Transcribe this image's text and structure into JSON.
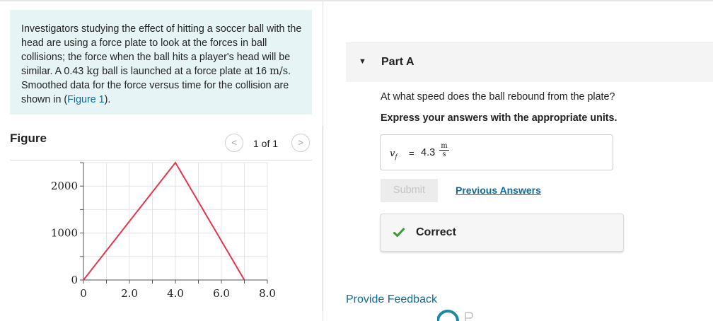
{
  "problem": {
    "text_1": "Investigators studying the effect of hitting a soccer ball with the head are using a force plate to look at the forces in ball collisions; the force when the ball hits a player's head will be similar. A 0.43 ",
    "mass_unit": "kg",
    "text_2": " ball is launched at a force plate at 16 ",
    "speed_unit": "m/s",
    "text_3": ". Smoothed data for the force versus time for the collision are shown in (",
    "figure_link": "Figure 1",
    "text_4": ")."
  },
  "figure": {
    "label": "Figure",
    "pager_text": "1 of 1",
    "prev_glyph": "<",
    "next_glyph": ">"
  },
  "chart_data": {
    "type": "line",
    "x": [
      0,
      4.0,
      7.0
    ],
    "series": [
      {
        "values": [
          0,
          2500,
          0
        ],
        "color": "#e8344a"
      }
    ],
    "x_ticks": [
      "0",
      "2.0",
      "4.0",
      "6.0",
      "8.0"
    ],
    "y_ticks": [
      "0",
      "1000",
      "2000"
    ],
    "xlim": [
      0,
      8.0
    ],
    "ylim": [
      0,
      2500
    ],
    "grid": true,
    "title": "",
    "xlabel": "",
    "ylabel": ""
  },
  "part": {
    "title": "Part A",
    "caret": "▼",
    "question": "At what speed does the ball rebound from the plate?",
    "instruction": "Express your answers with the appropriate units."
  },
  "answer": {
    "variable": "v",
    "subscript": "f",
    "equals": "=",
    "value": "4.3",
    "unit_numerator": "m",
    "unit_denominator": "s"
  },
  "buttons": {
    "submit": "Submit",
    "previous_answers": "Previous Answers"
  },
  "status": {
    "text": "Correct",
    "color": "#3a9a3a"
  },
  "footer": {
    "feedback": "Provide Feedback"
  },
  "colors": {
    "link": "#0c6c9e",
    "problem_bg": "#e6f4f6"
  }
}
